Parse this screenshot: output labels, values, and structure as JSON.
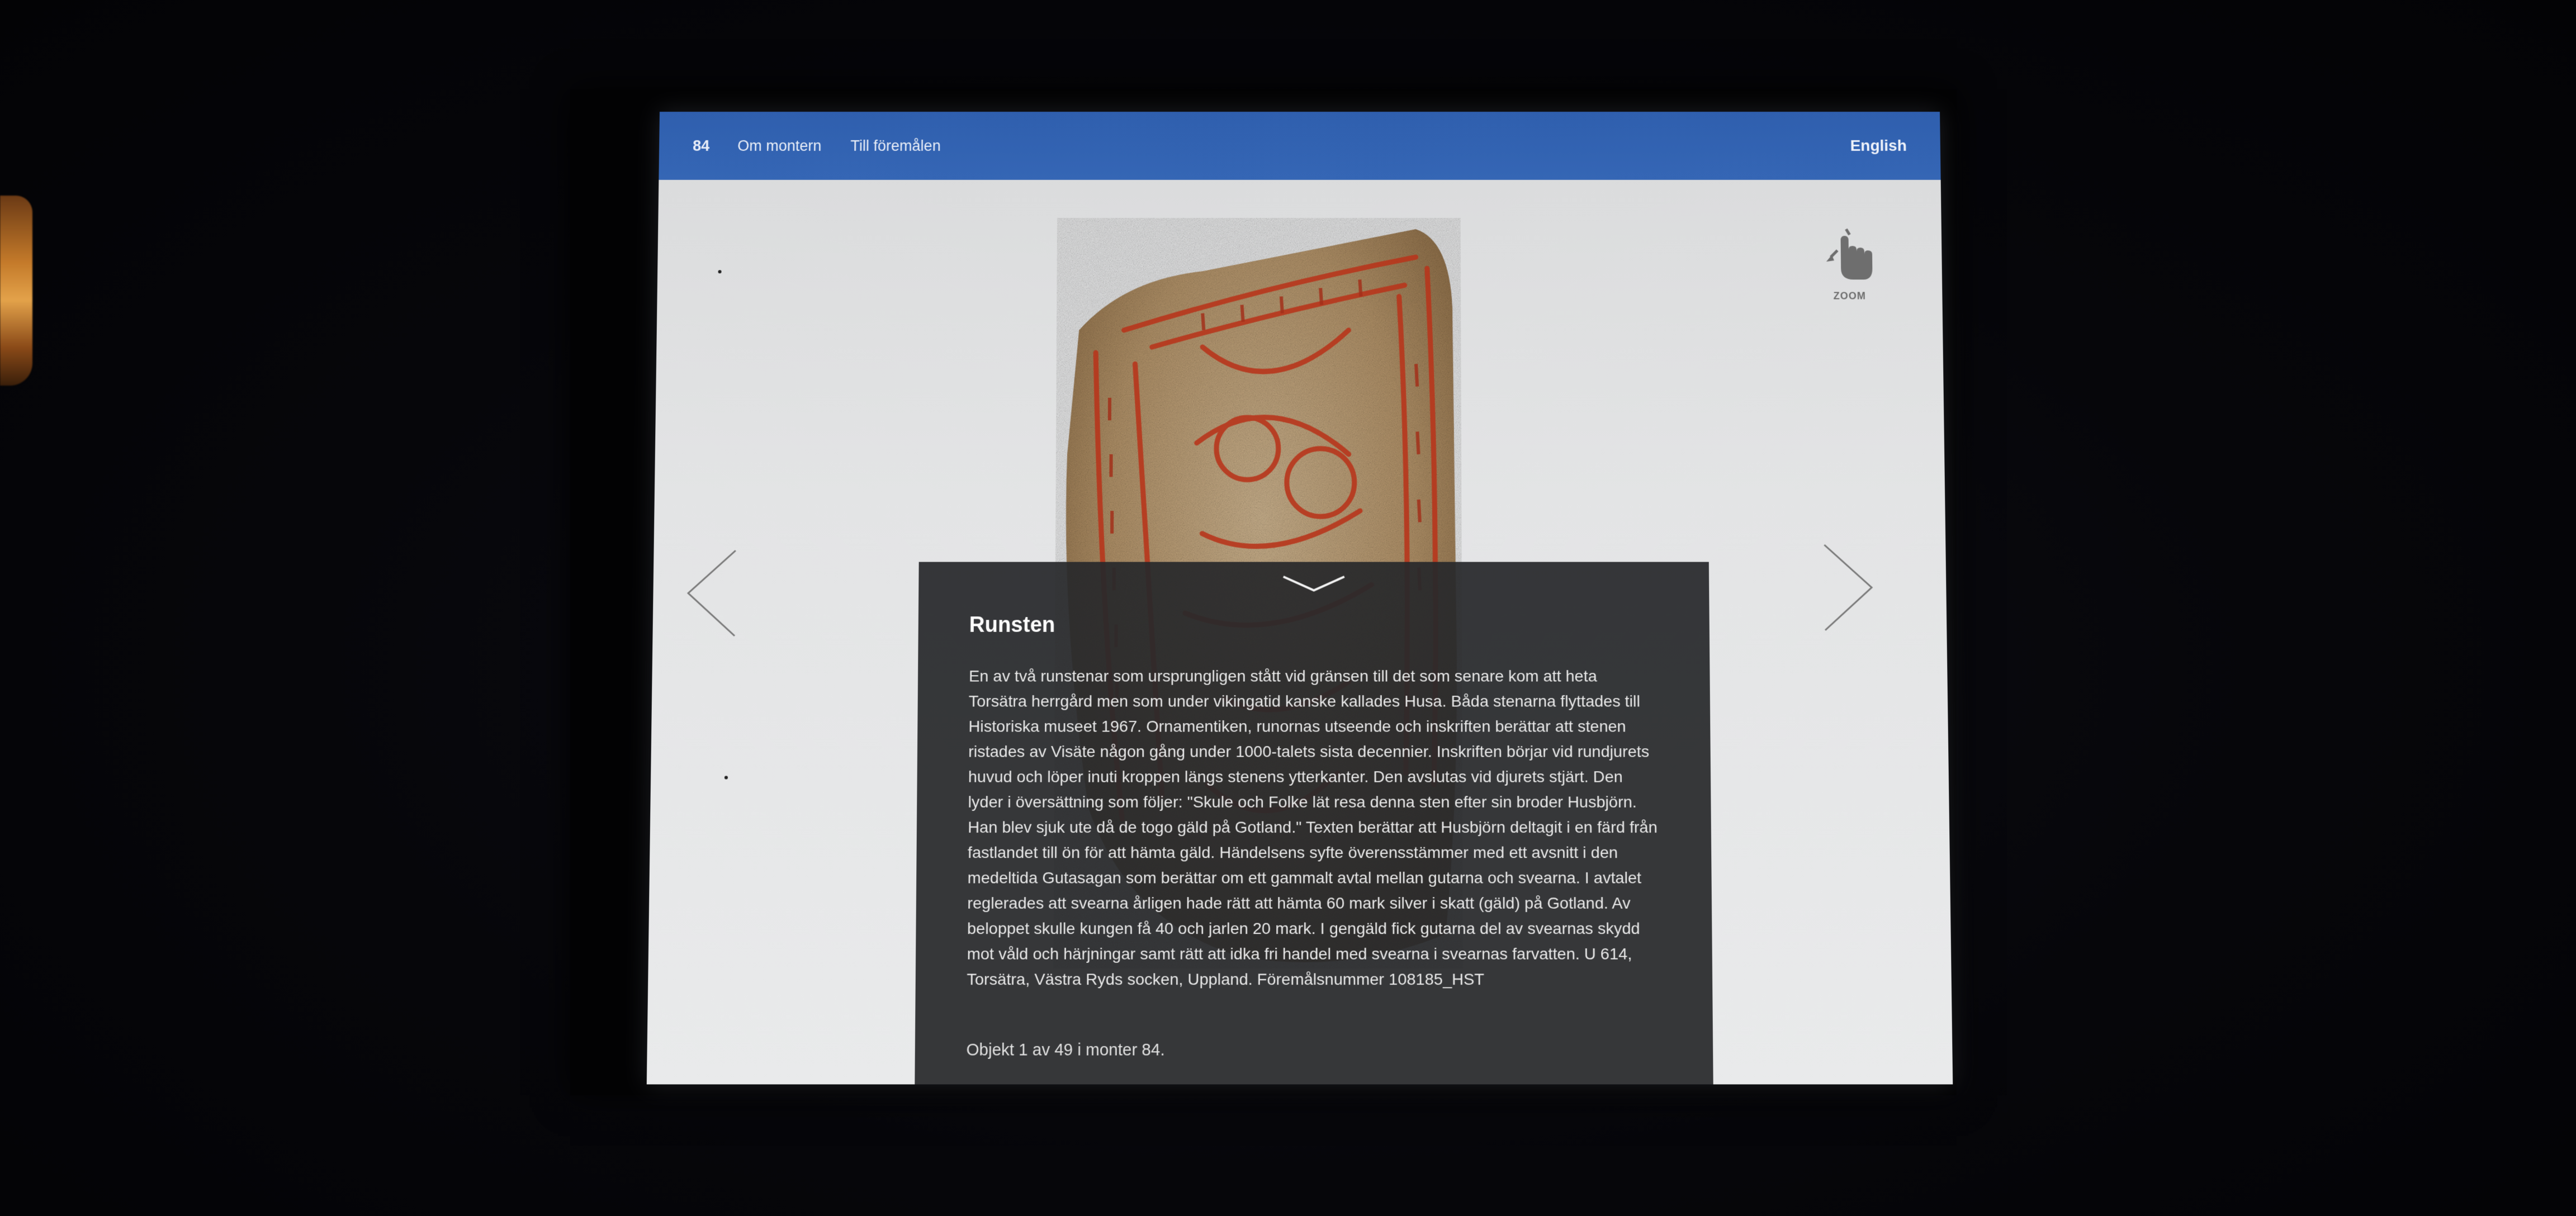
{
  "topbar": {
    "monter_number": "84",
    "nav_about": "Om montern",
    "nav_objects": "Till föremålen",
    "language": "English"
  },
  "zoom": {
    "label": "ZOOM",
    "icon": "hand-pinch-zoom-icon"
  },
  "navigation": {
    "prev_icon": "chevron-left-icon",
    "next_icon": "chevron-right-icon"
  },
  "object": {
    "image_icon": "runestone-image",
    "title": "Runsten",
    "description": "En av två runstenar som ursprungligen stått vid gränsen till det som senare kom att heta Torsätra herrgård men som under vikingatid kanske kallades Husa. Båda stenarna flyttades till Historiska museet 1967. Ornamentiken, runornas utseende och inskriften berättar att stenen ristades av Visäte någon gång under 1000-talets sista decennier. Inskriften börjar vid rundjurets huvud och löper inuti kroppen längs stenens ytterkanter. Den avslutas vid djurets stjärt. Den lyder i översättning som följer: \"Skule och Folke lät resa denna sten efter sin broder Husbjörn. Han blev sjuk ute då de togo gäld på Gotland.\" Texten berättar att Husbjörn deltagit i en färd från fastlandet till ön för att hämta gäld. Händelsens syfte överensstämmer med ett avsnitt i den medeltida Gutasagan som berättar om ett gammalt avtal mellan gutarna och svearna. I avtalet reglerades att svearna årligen hade rätt att hämta 60 mark silver i skatt (gäld) på Gotland. Av beloppet skulle kungen få 40 och jarlen 20 mark. I gengäld fick gutarna del av svearnas skydd mot våld och härjningar samt rätt att idka fri handel med svearna i svearnas farvatten. U 614, Torsätra, Västra Ryds socken, Uppland. Föremålsnummer 108185_HST",
    "counter": "Objekt 1 av 49 i monter 84."
  },
  "colors": {
    "topbar": "#3566b5",
    "screen_background": "#e3e4e5",
    "panel_background": "#28292b",
    "rune_red": "#b8361c"
  }
}
